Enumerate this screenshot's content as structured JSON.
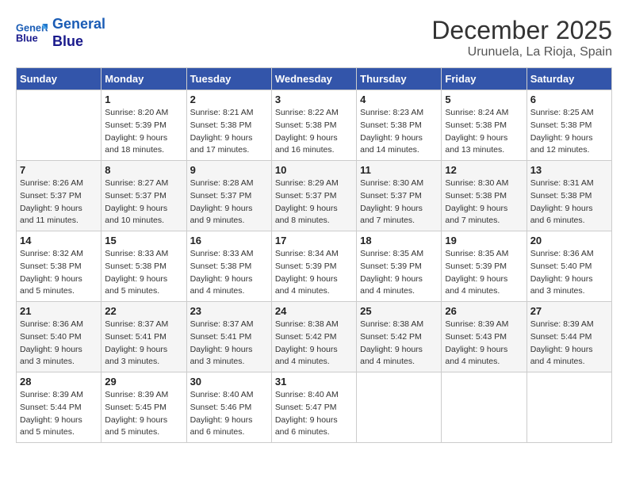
{
  "header": {
    "logo_line1": "General",
    "logo_line2": "Blue",
    "month_title": "December 2025",
    "location": "Urunuela, La Rioja, Spain"
  },
  "days_of_week": [
    "Sunday",
    "Monday",
    "Tuesday",
    "Wednesday",
    "Thursday",
    "Friday",
    "Saturday"
  ],
  "weeks": [
    [
      {
        "day": "",
        "sunrise": "",
        "sunset": "",
        "daylight": ""
      },
      {
        "day": "1",
        "sunrise": "8:20 AM",
        "sunset": "5:39 PM",
        "daylight": "9 hours and 18 minutes."
      },
      {
        "day": "2",
        "sunrise": "8:21 AM",
        "sunset": "5:38 PM",
        "daylight": "9 hours and 17 minutes."
      },
      {
        "day": "3",
        "sunrise": "8:22 AM",
        "sunset": "5:38 PM",
        "daylight": "9 hours and 16 minutes."
      },
      {
        "day": "4",
        "sunrise": "8:23 AM",
        "sunset": "5:38 PM",
        "daylight": "9 hours and 14 minutes."
      },
      {
        "day": "5",
        "sunrise": "8:24 AM",
        "sunset": "5:38 PM",
        "daylight": "9 hours and 13 minutes."
      },
      {
        "day": "6",
        "sunrise": "8:25 AM",
        "sunset": "5:38 PM",
        "daylight": "9 hours and 12 minutes."
      }
    ],
    [
      {
        "day": "7",
        "sunrise": "8:26 AM",
        "sunset": "5:37 PM",
        "daylight": "9 hours and 11 minutes."
      },
      {
        "day": "8",
        "sunrise": "8:27 AM",
        "sunset": "5:37 PM",
        "daylight": "9 hours and 10 minutes."
      },
      {
        "day": "9",
        "sunrise": "8:28 AM",
        "sunset": "5:37 PM",
        "daylight": "9 hours and 9 minutes."
      },
      {
        "day": "10",
        "sunrise": "8:29 AM",
        "sunset": "5:37 PM",
        "daylight": "9 hours and 8 minutes."
      },
      {
        "day": "11",
        "sunrise": "8:30 AM",
        "sunset": "5:37 PM",
        "daylight": "9 hours and 7 minutes."
      },
      {
        "day": "12",
        "sunrise": "8:30 AM",
        "sunset": "5:38 PM",
        "daylight": "9 hours and 7 minutes."
      },
      {
        "day": "13",
        "sunrise": "8:31 AM",
        "sunset": "5:38 PM",
        "daylight": "9 hours and 6 minutes."
      }
    ],
    [
      {
        "day": "14",
        "sunrise": "8:32 AM",
        "sunset": "5:38 PM",
        "daylight": "9 hours and 5 minutes."
      },
      {
        "day": "15",
        "sunrise": "8:33 AM",
        "sunset": "5:38 PM",
        "daylight": "9 hours and 5 minutes."
      },
      {
        "day": "16",
        "sunrise": "8:33 AM",
        "sunset": "5:38 PM",
        "daylight": "9 hours and 4 minutes."
      },
      {
        "day": "17",
        "sunrise": "8:34 AM",
        "sunset": "5:39 PM",
        "daylight": "9 hours and 4 minutes."
      },
      {
        "day": "18",
        "sunrise": "8:35 AM",
        "sunset": "5:39 PM",
        "daylight": "9 hours and 4 minutes."
      },
      {
        "day": "19",
        "sunrise": "8:35 AM",
        "sunset": "5:39 PM",
        "daylight": "9 hours and 4 minutes."
      },
      {
        "day": "20",
        "sunrise": "8:36 AM",
        "sunset": "5:40 PM",
        "daylight": "9 hours and 3 minutes."
      }
    ],
    [
      {
        "day": "21",
        "sunrise": "8:36 AM",
        "sunset": "5:40 PM",
        "daylight": "9 hours and 3 minutes."
      },
      {
        "day": "22",
        "sunrise": "8:37 AM",
        "sunset": "5:41 PM",
        "daylight": "9 hours and 3 minutes."
      },
      {
        "day": "23",
        "sunrise": "8:37 AM",
        "sunset": "5:41 PM",
        "daylight": "9 hours and 3 minutes."
      },
      {
        "day": "24",
        "sunrise": "8:38 AM",
        "sunset": "5:42 PM",
        "daylight": "9 hours and 4 minutes."
      },
      {
        "day": "25",
        "sunrise": "8:38 AM",
        "sunset": "5:42 PM",
        "daylight": "9 hours and 4 minutes."
      },
      {
        "day": "26",
        "sunrise": "8:39 AM",
        "sunset": "5:43 PM",
        "daylight": "9 hours and 4 minutes."
      },
      {
        "day": "27",
        "sunrise": "8:39 AM",
        "sunset": "5:44 PM",
        "daylight": "9 hours and 4 minutes."
      }
    ],
    [
      {
        "day": "28",
        "sunrise": "8:39 AM",
        "sunset": "5:44 PM",
        "daylight": "9 hours and 5 minutes."
      },
      {
        "day": "29",
        "sunrise": "8:39 AM",
        "sunset": "5:45 PM",
        "daylight": "9 hours and 5 minutes."
      },
      {
        "day": "30",
        "sunrise": "8:40 AM",
        "sunset": "5:46 PM",
        "daylight": "9 hours and 6 minutes."
      },
      {
        "day": "31",
        "sunrise": "8:40 AM",
        "sunset": "5:47 PM",
        "daylight": "9 hours and 6 minutes."
      },
      {
        "day": "",
        "sunrise": "",
        "sunset": "",
        "daylight": ""
      },
      {
        "day": "",
        "sunrise": "",
        "sunset": "",
        "daylight": ""
      },
      {
        "day": "",
        "sunrise": "",
        "sunset": "",
        "daylight": ""
      }
    ]
  ]
}
